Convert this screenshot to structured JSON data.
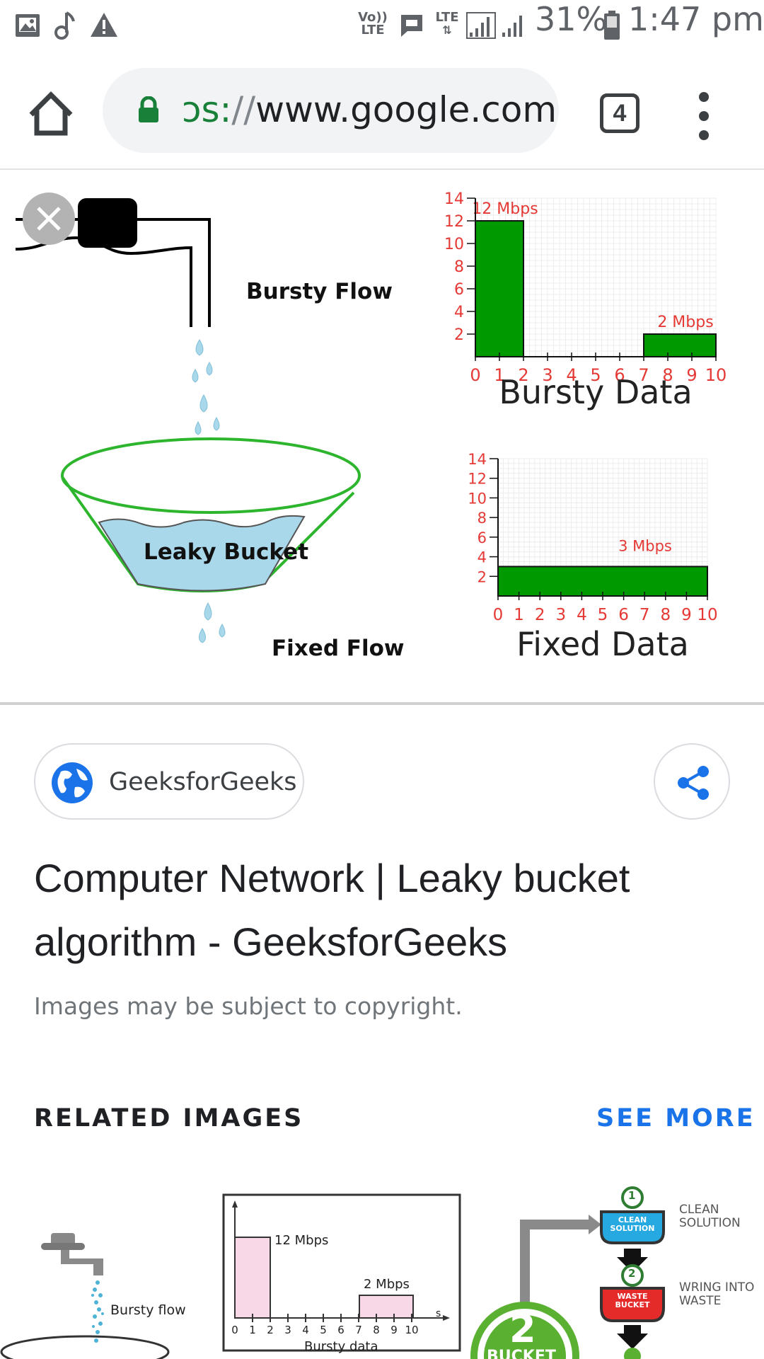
{
  "status_bar": {
    "volte": "Vo)) LTE",
    "lte": "LTE",
    "battery_percent": "31%",
    "time": "1:47 pm",
    "icons": [
      "image-icon",
      "music-note-icon",
      "warning-icon",
      "message-icon",
      "signal-icon",
      "battery-icon"
    ]
  },
  "browser": {
    "url_scheme": "ɔs:",
    "url_slashes": "//",
    "url_host": "www.google.com",
    "tab_count": "4",
    "icons": [
      "home-icon",
      "lock-icon",
      "tabs-icon",
      "more-vert-icon"
    ]
  },
  "image": {
    "labels": {
      "bursty_flow": "Bursty Flow",
      "leaky_bucket": "Leaky Bucket",
      "fixed_flow": "Fixed Flow"
    },
    "close_icon": "close-icon"
  },
  "chart_data": [
    {
      "type": "bar",
      "title": "Bursty Data",
      "x_ticks": [
        "0",
        "1",
        "2",
        "3",
        "4",
        "5",
        "6",
        "7",
        "8",
        "9",
        "10"
      ],
      "y_ticks": [
        "2",
        "4",
        "6",
        "8",
        "10",
        "12",
        "14"
      ],
      "xlim": [
        0,
        10
      ],
      "ylim": [
        0,
        14
      ],
      "grid": true,
      "bars": [
        {
          "x_start": 0,
          "x_end": 2,
          "value": 12,
          "label": "12 Mbps"
        },
        {
          "x_start": 7,
          "x_end": 10,
          "value": 2,
          "label": "2 Mbps"
        }
      ],
      "bar_color": "#009900",
      "tick_color": "#e53935"
    },
    {
      "type": "bar",
      "title": "Fixed Data",
      "x_ticks": [
        "0",
        "1",
        "2",
        "3",
        "4",
        "5",
        "6",
        "7",
        "8",
        "9",
        "10"
      ],
      "y_ticks": [
        "2",
        "4",
        "6",
        "8",
        "10",
        "12",
        "14"
      ],
      "xlim": [
        0,
        10
      ],
      "ylim": [
        0,
        14
      ],
      "grid": true,
      "bars": [
        {
          "x_start": 0,
          "x_end": 10,
          "value": 3,
          "label": "3 Mbps"
        }
      ],
      "bar_color": "#009900",
      "tick_color": "#e53935"
    }
  ],
  "card": {
    "source_name": "GeeksforGeeks",
    "title": "Computer Network | Leaky bucket algorithm - GeeksforGeeks",
    "copyright": "Images may be subject to copyright.",
    "icons": [
      "globe-icon",
      "share-icon"
    ]
  },
  "related": {
    "label": "RELATED IMAGES",
    "see_more": "SEE MORE",
    "thumbs": {
      "t1_label": "Bursty flow",
      "t2_bar1_label": "12 Mbps",
      "t2_bar2_label": "2 Mbps",
      "t2_axis_ticks": [
        "0",
        "1",
        "2",
        "3",
        "4",
        "5",
        "6",
        "7",
        "8",
        "9",
        "10"
      ],
      "t2_caption": "Bursty data",
      "t2_axis_unit": "s",
      "t3_step1_number": "1",
      "t3_step1_badge": "CLEAN SOLUTION",
      "t3_step1_label": "CLEAN SOLUTION",
      "t3_step2_number": "2",
      "t3_step2_badge": "WASTE BUCKET",
      "t3_step2_label": "WRING INTO WASTE",
      "t3_big_number": "2",
      "t3_big_label": "BUCKET"
    }
  }
}
